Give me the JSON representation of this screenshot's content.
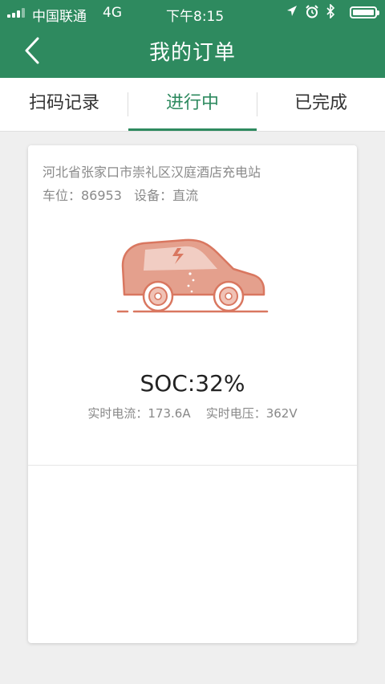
{
  "status_bar": {
    "carrier": "中国联通",
    "network": "4G",
    "time": "下午8:15"
  },
  "nav": {
    "title": "我的订单"
  },
  "tabs": [
    {
      "label": "扫码记录",
      "active": false
    },
    {
      "label": "进行中",
      "active": true
    },
    {
      "label": "已完成",
      "active": false
    }
  ],
  "order": {
    "station": "河北省张家口市崇礼区汉庭酒店充电站",
    "spot_label": "车位：86953",
    "device_label": "设备：直流",
    "soc": "SOC:32%",
    "current": "实时电流：173.6A",
    "voltage": "实时电压：362V"
  },
  "colors": {
    "brand_green": "#2e8a5f",
    "car_fill": "#e4a08d",
    "car_stroke": "#d97760"
  }
}
